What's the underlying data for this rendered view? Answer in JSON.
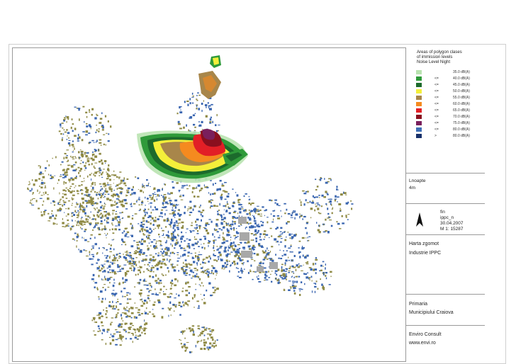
{
  "legend": {
    "title_lines": [
      "Areas of polygon clases",
      "of immission levels",
      "Noise Level Night"
    ],
    "rows": [
      {
        "op": "",
        "level": "35.0 dB(A)",
        "color": "#b9e3b0"
      },
      {
        "op": "<=",
        "level": "40.0 dB(A)",
        "color": "#2f9a3a"
      },
      {
        "op": "<=",
        "level": "45.0 dB(A)",
        "color": "#1c6a2c"
      },
      {
        "op": "<=",
        "level": "50.0 dB(A)",
        "color": "#f4ef3a"
      },
      {
        "op": "<=",
        "level": "55.0 dB(A)",
        "color": "#a8864a"
      },
      {
        "op": "<=",
        "level": "60.0 dB(A)",
        "color": "#f58a1f"
      },
      {
        "op": "<=",
        "level": "65.0 dB(A)",
        "color": "#e21f26"
      },
      {
        "op": "<=",
        "level": "70.0 dB(A)",
        "color": "#8a0f1e"
      },
      {
        "op": "<=",
        "level": "75.0 dB(A)",
        "color": "#7a1f5c"
      },
      {
        "op": "<=",
        "level": "80.0 dB(A)",
        "color": "#3e6fb6"
      },
      {
        "op": ">",
        "level": "80.0 dB(A)",
        "color": "#17306a"
      }
    ]
  },
  "info": {
    "variant": "Lnoapte",
    "height": "4m",
    "file": "fin",
    "project": "ippc_n",
    "date": "30.04.2007",
    "scale": "M 1:  15287",
    "map_title": "Harta zgomot",
    "map_subtitle": "Industrie IPPC",
    "client_line1": "Primaria",
    "client_line2": "Municipiului Craiova",
    "company": "Enviro Consult",
    "website": "www.envi.ro"
  },
  "map": {
    "north_arrow_icon": "north-arrow-icon",
    "colors": {
      "buildings_blue": "#3a66b0",
      "buildings_olive": "#8f8a45",
      "industrial_grey": "#a8a8a8"
    }
  }
}
